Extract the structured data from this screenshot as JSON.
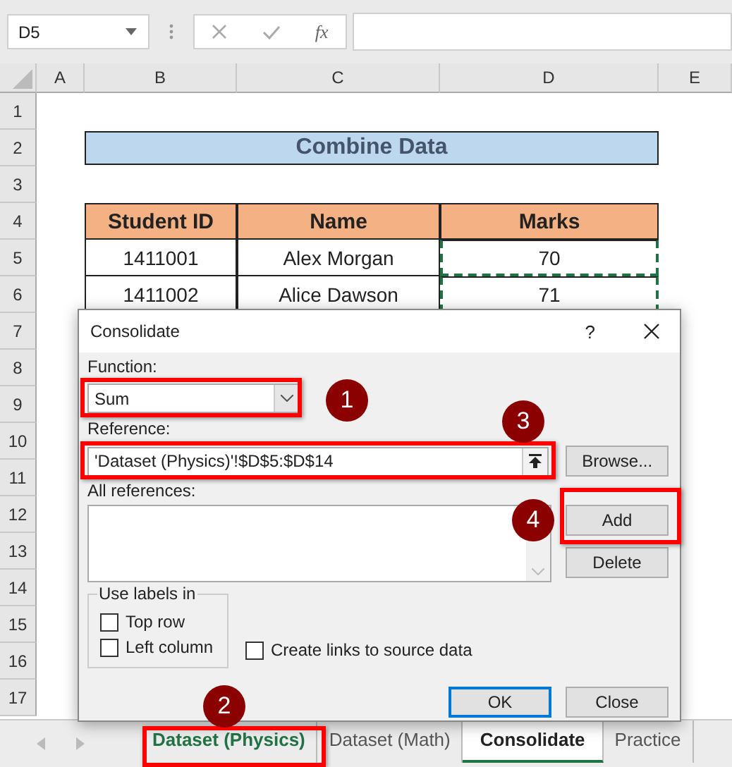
{
  "name_box": {
    "value": "D5"
  },
  "formula_bar": {
    "function_label": "fx"
  },
  "column_headers": [
    "A",
    "B",
    "C",
    "D",
    "E"
  ],
  "row_headers": [
    "1",
    "2",
    "3",
    "4",
    "5",
    "6",
    "7",
    "8",
    "9",
    "10",
    "11",
    "12",
    "13",
    "14",
    "15",
    "16",
    "17"
  ],
  "sheet_title": "Combine Data",
  "table": {
    "columns": [
      "Student ID",
      "Name",
      "Marks"
    ],
    "rows": [
      [
        "1411001",
        "Alex Morgan",
        "70"
      ],
      [
        "1411002",
        "Alice Dawson",
        "71"
      ]
    ]
  },
  "dialog": {
    "title": "Consolidate",
    "help": "?",
    "function_label": "Function:",
    "function_value": "Sum",
    "reference_label": "Reference:",
    "reference_value": "'Dataset (Physics)'!$D$5:$D$14",
    "browse": "Browse...",
    "all_references_label": "All references:",
    "add": "Add",
    "delete": "Delete",
    "labels_group": "Use labels in",
    "label_options": [
      {
        "label": "Top row",
        "checked": false
      },
      {
        "label": "Left column",
        "checked": false
      }
    ],
    "create_links": {
      "label": "Create links to source data",
      "checked": false
    },
    "ok": "OK",
    "close": "Close"
  },
  "step_badges": [
    "1",
    "2",
    "3",
    "4"
  ],
  "sheet_tabs": [
    {
      "label": "Dataset (Physics)",
      "selected": false,
      "grouped": true
    },
    {
      "label": "Dataset (Math)",
      "selected": false,
      "grouped": false
    },
    {
      "label": "Consolidate",
      "selected": true,
      "grouped": false
    },
    {
      "label": "Practice",
      "selected": false,
      "grouped": false
    }
  ]
}
